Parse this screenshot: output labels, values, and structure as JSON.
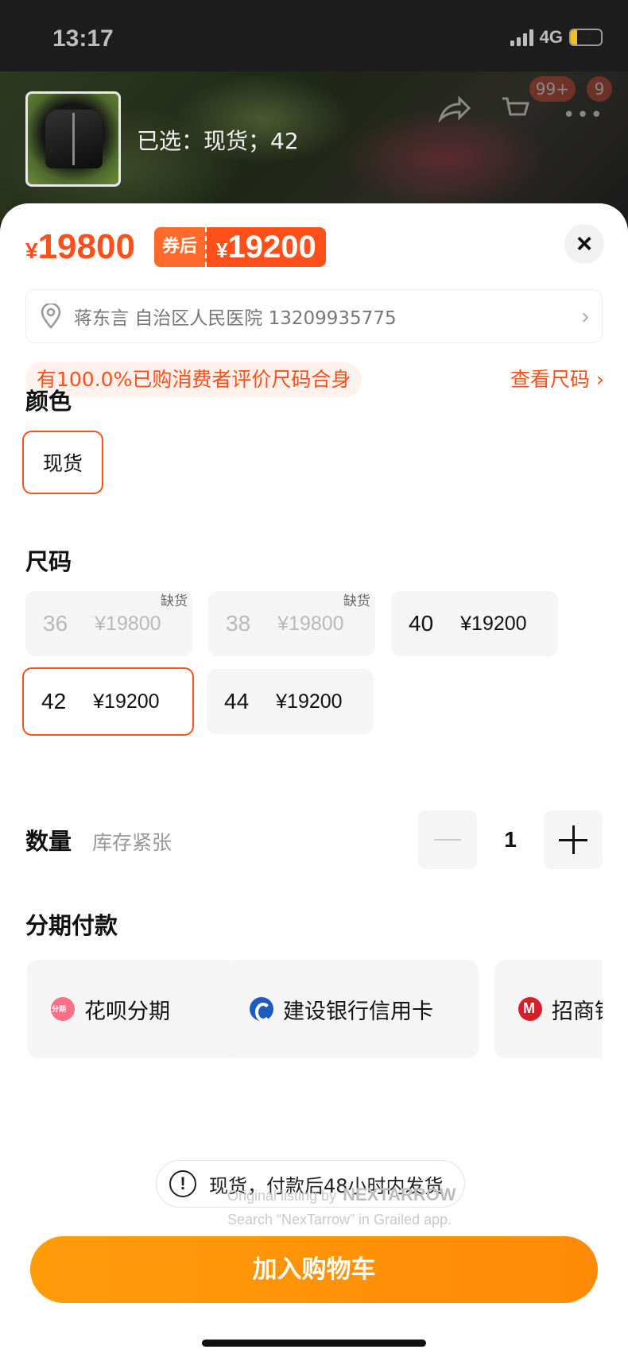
{
  "status_bar": {
    "time": "13:17",
    "network": "4G",
    "battery": "21"
  },
  "header": {
    "selected_label": "已选：现货；42",
    "badge_messages": "99+",
    "badge_cart": "9"
  },
  "pricing": {
    "currency": "¥",
    "original_price": "19800",
    "coupon_tag": "券后",
    "coupon_price": "19200",
    "close_glyph": "×"
  },
  "address": {
    "text": "蒋东言 自治区人民医院 13209935775",
    "arrow": "›"
  },
  "fit": {
    "tip": "有100.0%已购消费者评价尺码合身",
    "size_guide": "查看尺码 ›"
  },
  "color_section": {
    "title": "颜色",
    "options": [
      {
        "label": "现货",
        "selected": true
      }
    ]
  },
  "size_section": {
    "title": "尺码",
    "out_of_stock_label": "缺货",
    "options": [
      {
        "size": "36",
        "price": "¥19800",
        "available": false
      },
      {
        "size": "38",
        "price": "¥19800",
        "available": false
      },
      {
        "size": "40",
        "price": "¥19200",
        "available": true
      },
      {
        "size": "42",
        "price": "¥19200",
        "available": true,
        "selected": true
      },
      {
        "size": "44",
        "price": "¥19200",
        "available": true
      }
    ]
  },
  "quantity": {
    "label": "数量",
    "note": "库存紧张",
    "value": "1"
  },
  "installments": {
    "title": "分期付款",
    "options": [
      {
        "label": "花呗分期",
        "icon": "huabei-icon"
      },
      {
        "label": "建设银行信用卡",
        "icon": "ccb-icon"
      },
      {
        "label": "招商银行信用卡",
        "icon": "cmb-icon"
      }
    ]
  },
  "shipping": {
    "icon_glyph": "!",
    "note": "现货，付款后48小时内发货"
  },
  "watermark": {
    "line1": "Original listing by",
    "brand": "NEXTARROW",
    "line2": "Search “NexTarrow” in Grailed app."
  },
  "cta": {
    "add_to_cart": "加入购物车"
  },
  "colors": {
    "accent": "#ff4f1a",
    "cta": "#ff9c0a",
    "chip_bg": "#f5f5f5"
  }
}
